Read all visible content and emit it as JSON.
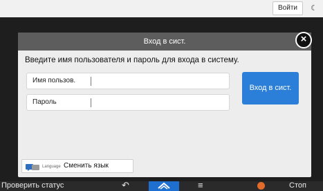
{
  "top_bar": {
    "login_label": "Войти",
    "moon_glyph": "☾"
  },
  "dialog": {
    "title": "Вход в сист.",
    "close_glyph": "×",
    "instruction": "Введите имя пользователя и пароль для входа в систему.",
    "username_label": "Имя пользов.",
    "username_value": "",
    "password_label": "Пароль",
    "password_value": "",
    "submit_label": "Вход в сист.",
    "language_small": "Language",
    "language_label": "Сменить язык"
  },
  "bottom_bar": {
    "status_label": "Проверить статус",
    "back_glyph": "↶",
    "menu_glyph": "≡",
    "stop_label": "Стоп"
  },
  "icons": {
    "close": "close-icon",
    "moon": "moon-icon",
    "language": "language-icon",
    "back": "back-icon",
    "home": "home-icon",
    "menu": "menu-icon",
    "stop": "stop-icon"
  },
  "colors": {
    "accent": "#2b7fd8",
    "home_active": "#1f6fd0",
    "header": "#5d5d5d",
    "stop": "#e36b2a"
  }
}
